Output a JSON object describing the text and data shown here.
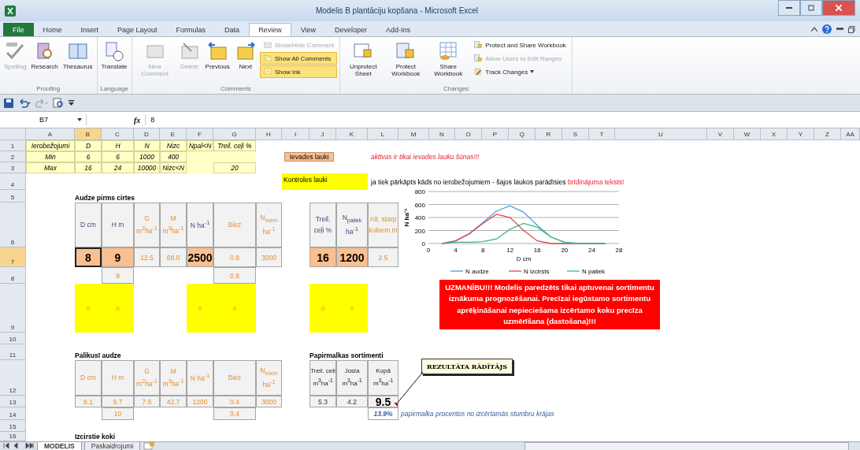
{
  "window": {
    "title": "Modelis B plantāciju kopšana - Microsoft Excel"
  },
  "ribbon": {
    "tabs": [
      {
        "label": "File",
        "kind": "file",
        "selected": false
      },
      {
        "label": "Home",
        "kind": "tab",
        "selected": false
      },
      {
        "label": "Insert",
        "kind": "tab",
        "selected": false
      },
      {
        "label": "Page Layout",
        "kind": "tab",
        "selected": false
      },
      {
        "label": "Formulas",
        "kind": "tab",
        "selected": false
      },
      {
        "label": "Data",
        "kind": "tab",
        "selected": false
      },
      {
        "label": "Review",
        "kind": "tab",
        "selected": true
      },
      {
        "label": "View",
        "kind": "tab",
        "selected": false
      },
      {
        "label": "Developer",
        "kind": "tab",
        "selected": false
      },
      {
        "label": "Add-Ins",
        "kind": "tab",
        "selected": false
      }
    ],
    "groups": [
      {
        "label": "Proofing",
        "buttons": [
          {
            "label": "Spelling",
            "kind": "large",
            "disabled": true,
            "highlighted": false
          },
          {
            "label": "Research",
            "kind": "large",
            "disabled": false,
            "highlighted": false
          },
          {
            "label": "Thesaurus",
            "kind": "large",
            "disabled": false,
            "highlighted": false
          }
        ]
      },
      {
        "label": "Language",
        "buttons": [
          {
            "label": "Translate",
            "kind": "large",
            "disabled": false,
            "highlighted": false
          }
        ]
      },
      {
        "label": "Comments",
        "buttons": [
          {
            "label": "New Comment",
            "kind": "large",
            "disabled": true,
            "highlighted": false
          },
          {
            "label": "Delete",
            "kind": "large",
            "disabled": true,
            "highlighted": false
          },
          {
            "label": "Previous",
            "kind": "large",
            "disabled": false,
            "highlighted": false
          },
          {
            "label": "Next",
            "kind": "large",
            "disabled": false,
            "highlighted": false
          },
          {
            "label": "Show/Hide Comment",
            "kind": "small",
            "disabled": true,
            "highlighted": false
          },
          {
            "label": "Show All Comments",
            "kind": "small",
            "disabled": false,
            "highlighted": true
          },
          {
            "label": "Show Ink",
            "kind": "small",
            "disabled": false,
            "highlighted": true
          }
        ]
      },
      {
        "label": "Changes",
        "buttons": [
          {
            "label": "Unprotect Sheet",
            "kind": "large",
            "disabled": false,
            "highlighted": false
          },
          {
            "label": "Protect Workbook",
            "kind": "large",
            "disabled": false,
            "highlighted": false
          },
          {
            "label": "Share Workbook",
            "kind": "large",
            "disabled": false,
            "highlighted": false
          },
          {
            "label": "Protect and Share Workbook",
            "kind": "small",
            "disabled": false,
            "highlighted": false
          },
          {
            "label": "Allow Users to Edit Ranges",
            "kind": "small",
            "disabled": true,
            "highlighted": false
          },
          {
            "label": "Track Changes",
            "kind": "dropdown",
            "disabled": false,
            "highlighted": false
          }
        ]
      }
    ]
  },
  "formula_bar": {
    "name_box": "B7",
    "function_label": "fx",
    "value": "8"
  },
  "sheet": {
    "columns": [
      {
        "label": "A",
        "selected": false
      },
      {
        "label": "B",
        "selected": true
      },
      {
        "label": "C",
        "selected": false
      },
      {
        "label": "D",
        "selected": false
      },
      {
        "label": "E",
        "selected": false
      },
      {
        "label": "F",
        "selected": false
      },
      {
        "label": "G",
        "selected": false
      },
      {
        "label": "H",
        "selected": false
      },
      {
        "label": "I",
        "selected": false
      },
      {
        "label": "J",
        "selected": false
      },
      {
        "label": "K",
        "selected": false
      },
      {
        "label": "L",
        "selected": false
      },
      {
        "label": "M",
        "selected": false
      },
      {
        "label": "N",
        "selected": false
      },
      {
        "label": "O",
        "selected": false
      },
      {
        "label": "P",
        "selected": false
      },
      {
        "label": "Q",
        "selected": false
      },
      {
        "label": "R",
        "selected": false
      },
      {
        "label": "S",
        "selected": false
      },
      {
        "label": "T",
        "selected": false
      },
      {
        "label": "U",
        "selected": false
      },
      {
        "label": "V",
        "selected": false
      },
      {
        "label": "W",
        "selected": false
      },
      {
        "label": "X",
        "selected": false
      },
      {
        "label": "Y",
        "selected": false
      },
      {
        "label": "Z",
        "selected": false
      },
      {
        "label": "AA",
        "selected": false
      }
    ],
    "rows": [
      {
        "label": "1",
        "selected": false
      },
      {
        "label": "2",
        "selected": false
      },
      {
        "label": "3",
        "selected": false
      },
      {
        "label": "4",
        "selected": false
      },
      {
        "label": "5",
        "selected": false
      },
      {
        "label": "6",
        "selected": false
      },
      {
        "label": "7",
        "selected": true
      },
      {
        "label": "8",
        "selected": false
      },
      {
        "label": "9",
        "selected": false
      },
      {
        "label": "10",
        "selected": false
      },
      {
        "label": "11",
        "selected": false
      },
      {
        "label": "12",
        "selected": false
      },
      {
        "label": "13",
        "selected": false
      },
      {
        "label": "14",
        "selected": false
      },
      {
        "label": "15",
        "selected": false
      },
      {
        "label": "16",
        "selected": false
      }
    ],
    "cells": [
      {
        "kind": "limit",
        "text": "Ierobežojumi",
        "selected": false
      },
      {
        "kind": "limit",
        "text": "D",
        "selected": false
      },
      {
        "kind": "limit",
        "text": "H",
        "selected": false
      },
      {
        "kind": "limit",
        "text": "N",
        "selected": false
      },
      {
        "kind": "limit",
        "text": "Nizc",
        "selected": false
      },
      {
        "kind": "limit",
        "text": "Npal<N",
        "selected": false
      },
      {
        "kind": "limit",
        "text": "Treil. ceļi %",
        "selected": false
      },
      {
        "kind": "limit",
        "text": "Min",
        "selected": false
      },
      {
        "kind": "limit",
        "text": "6",
        "selected": false
      },
      {
        "kind": "limit",
        "text": "6",
        "selected": false
      },
      {
        "kind": "limit",
        "text": "1000",
        "selected": false
      },
      {
        "kind": "limit",
        "text": "400",
        "selected": false
      },
      {
        "kind": "limit",
        "text": "Max",
        "selected": false
      },
      {
        "kind": "limit",
        "text": "16",
        "selected": false
      },
      {
        "kind": "limit",
        "text": "24",
        "selected": false
      },
      {
        "kind": "limit",
        "text": "10000",
        "selected": false
      },
      {
        "kind": "limit",
        "text": "Nizc<N",
        "selected": false
      },
      {
        "kind": "limit",
        "text": "20",
        "selected": false
      },
      {
        "kind": "legend_input",
        "text": "Ievades lauki",
        "selected": false
      },
      {
        "kind": "note_red",
        "text": "aktīvas ir tikai ievades lauku šūnas!!!",
        "selected": false
      },
      {
        "kind": "legend_control",
        "text": "Kontroles lauki",
        "selected": false
      },
      {
        "kind": "note_mixed",
        "text": "ja tiek pārkāpts kāds no ierobežojumiem - šajos laukos parādīsies",
        "highlight": "brīdinājuma teksts!",
        "selected": false
      },
      {
        "kind": "title",
        "text": "Audze pirms cirtes",
        "selected": false
      },
      {
        "kind": "header",
        "text": "D cm",
        "selected": false
      },
      {
        "kind": "header",
        "text": "H m",
        "selected": false
      },
      {
        "kind": "header_out",
        "text": "G m$^{2}$ha$^{-1}$",
        "selected": false
      },
      {
        "kind": "header_out",
        "text": "M m$^{3}$ha$^{-1}$",
        "selected": false
      },
      {
        "kind": "header",
        "text": "N ha$^{-1}$",
        "selected": false
      },
      {
        "kind": "header_out",
        "text": "Biez",
        "selected": false
      },
      {
        "kind": "header_out",
        "text": "N$_{norm}$ ha$^{-1}$",
        "selected": false
      },
      {
        "kind": "header",
        "text": "Treil. ceļi %",
        "selected": false
      },
      {
        "kind": "header",
        "text": "N$_{paliek}$ ha$^{-1}$",
        "selected": false
      },
      {
        "kind": "header_out",
        "text": "Att. starp kokiem m",
        "selected": false
      },
      {
        "kind": "input",
        "text": "8",
        "selected": true
      },
      {
        "kind": "input",
        "text": "9",
        "selected": false
      },
      {
        "kind": "calc",
        "text": "12.5",
        "selected": false
      },
      {
        "kind": "calc",
        "text": "68.0",
        "selected": false
      },
      {
        "kind": "input",
        "text": "2500",
        "selected": false
      },
      {
        "kind": "calc",
        "text": "0.8",
        "selected": false
      },
      {
        "kind": "calc",
        "text": "3000",
        "selected": false
      },
      {
        "kind": "input",
        "text": "16",
        "selected": false
      },
      {
        "kind": "input",
        "text": "1200",
        "selected": false
      },
      {
        "kind": "calc",
        "text": "2.5",
        "selected": false
      },
      {
        "kind": "calc",
        "text": "9",
        "selected": false
      },
      {
        "kind": "calc",
        "text": "0.8",
        "selected": false
      },
      {
        "kind": "control",
        "text": "0",
        "selected": false
      },
      {
        "kind": "control",
        "text": "0",
        "selected": false
      },
      {
        "kind": "control",
        "text": "0",
        "selected": false
      },
      {
        "kind": "control",
        "text": "0",
        "selected": false
      },
      {
        "kind": "control",
        "text": "0",
        "selected": false
      },
      {
        "kind": "control",
        "text": "0",
        "selected": false
      },
      {
        "kind": "title",
        "text": "Palikusī audze",
        "selected": false
      },
      {
        "kind": "title",
        "text": "Papirmalkas sortimenti",
        "selected": false
      },
      {
        "kind": "header_out",
        "text": "D cm",
        "selected": false
      },
      {
        "kind": "header_out",
        "text": "H m",
        "selected": false
      },
      {
        "kind": "header_out",
        "text": "G m$^{2}$ha$^{-1}$",
        "selected": false
      },
      {
        "kind": "header_out",
        "text": "M m$^{3}$ha$^{-1}$",
        "selected": false
      },
      {
        "kind": "header_out",
        "text": "N ha$^{-1}$",
        "selected": false
      },
      {
        "kind": "header_out",
        "text": "Biez",
        "selected": false
      },
      {
        "kind": "header_out",
        "text": "N$_{norm}$ ha$^{-1}$",
        "selected": false
      },
      {
        "kind": "header_plain",
        "text": "Treil. ceļi m$^{3}$ha$^{-1}$",
        "selected": false
      },
      {
        "kind": "header_plain",
        "text": "Josla m$^{3}$ha$^{-1}$",
        "selected": false
      },
      {
        "kind": "header_plain",
        "text": "Kopā m$^{3}$ha$^{-1}$",
        "selected": false
      },
      {
        "kind": "calc",
        "text": "9.1",
        "selected": false
      },
      {
        "kind": "calc",
        "text": "9.7",
        "selected": false
      },
      {
        "kind": "calc",
        "text": "7.6",
        "selected": false
      },
      {
        "kind": "calc",
        "text": "42.7",
        "selected": false
      },
      {
        "kind": "calc",
        "text": "1200",
        "selected": false
      },
      {
        "kind": "calc",
        "text": "0.4",
        "selected": false
      },
      {
        "kind": "calc",
        "text": "3000",
        "selected": false
      },
      {
        "kind": "plain",
        "text": "5.3",
        "selected": false
      },
      {
        "kind": "plain",
        "text": "4.2",
        "selected": false
      },
      {
        "kind": "result",
        "text": "9.5",
        "selected": false
      },
      {
        "kind": "calc",
        "text": "10",
        "selected": false
      },
      {
        "kind": "calc",
        "text": "0.4",
        "selected": false
      },
      {
        "kind": "percent",
        "text": "13.9%",
        "selected": false
      },
      {
        "kind": "note_blue",
        "text": "papirmalka procentos no izcērtamās stumbru krājas",
        "selected": false
      },
      {
        "kind": "title",
        "text": "Izcirstie koki",
        "selected": false
      }
    ],
    "warning": {
      "text": "UZMANĪBU!!! Modelis paredzēts tikai aptuvenai sortimentu iznākuma prognozēšanai. Precīzai iegūstamo sortimentu aprēķināšanai nepieciešama  izcērtamo koku precīza uzmērīšana (dastošana)!!!"
    },
    "comment": {
      "text": "REZULTĀTA RĀDĪTĀJS"
    },
    "chart_data": {
      "type": "line",
      "xlabel": "D cm",
      "ylabel": "N ha⁻¹",
      "grid": true,
      "legend": true,
      "x": [
        2,
        4,
        6,
        8,
        10,
        12,
        14,
        16,
        18,
        20,
        22,
        24,
        26
      ],
      "series": [
        {
          "name": "N audze",
          "color": "#4a9fd8",
          "values": [
            0,
            40,
            150,
            320,
            500,
            580,
            480,
            280,
            100,
            20,
            0,
            0,
            0
          ]
        },
        {
          "name": "N izcirsts",
          "color": "#e0474c",
          "values": [
            0,
            40,
            150,
            310,
            450,
            400,
            200,
            40,
            0,
            0,
            0,
            0,
            0
          ]
        },
        {
          "name": "N paliek",
          "color": "#3cb88a",
          "values": [
            0,
            20,
            20,
            30,
            70,
            220,
            310,
            250,
            100,
            20,
            0,
            0,
            0
          ]
        }
      ],
      "xlim": [
        0,
        28
      ],
      "ylim": [
        0,
        800
      ],
      "xticks": [
        {
          "value": 0,
          "label": "0"
        },
        {
          "value": 4,
          "label": "4"
        },
        {
          "value": 8,
          "label": "8"
        },
        {
          "value": 12,
          "label": "12"
        },
        {
          "value": 16,
          "label": "16"
        },
        {
          "value": 20,
          "label": "20"
        },
        {
          "value": 24,
          "label": "24"
        },
        {
          "value": 28,
          "label": "28"
        }
      ],
      "yticks": [
        {
          "value": 0,
          "label": "0"
        },
        {
          "value": 200,
          "label": "200"
        },
        {
          "value": 400,
          "label": "400"
        },
        {
          "value": 600,
          "label": "600"
        },
        {
          "value": 800,
          "label": "800"
        }
      ]
    },
    "sheet_tabs": [
      {
        "label": "MODELIS",
        "selected": true
      },
      {
        "label": "Paskaidrojumi",
        "selected": false
      }
    ]
  }
}
